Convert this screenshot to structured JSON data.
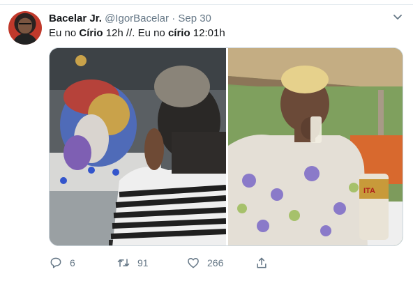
{
  "tweet": {
    "author_name": "Bacelar Jr.",
    "author_handle": "@IgorBacelar",
    "separator": "·",
    "date": "Sep 30",
    "text_parts": [
      "Eu no ",
      "Círio",
      " 12h  //.  Eu no ",
      "círio",
      " 12:01h"
    ]
  },
  "actions": {
    "reply_count": "6",
    "retweet_count": "91",
    "like_count": "266"
  },
  "media": {
    "left_photo": "photo-altar-woman-praying",
    "right_photo": "photo-woman-drinking-with-beer-can",
    "beer_can_text": "ITA"
  },
  "icons": {
    "reply": "comment-icon",
    "retweet": "retweet-icon",
    "like": "heart-icon",
    "share": "share-icon",
    "menu": "chevron-down-icon"
  },
  "colors": {
    "text": "#14171a",
    "muted": "#657786",
    "divider": "#e6ecf0"
  }
}
